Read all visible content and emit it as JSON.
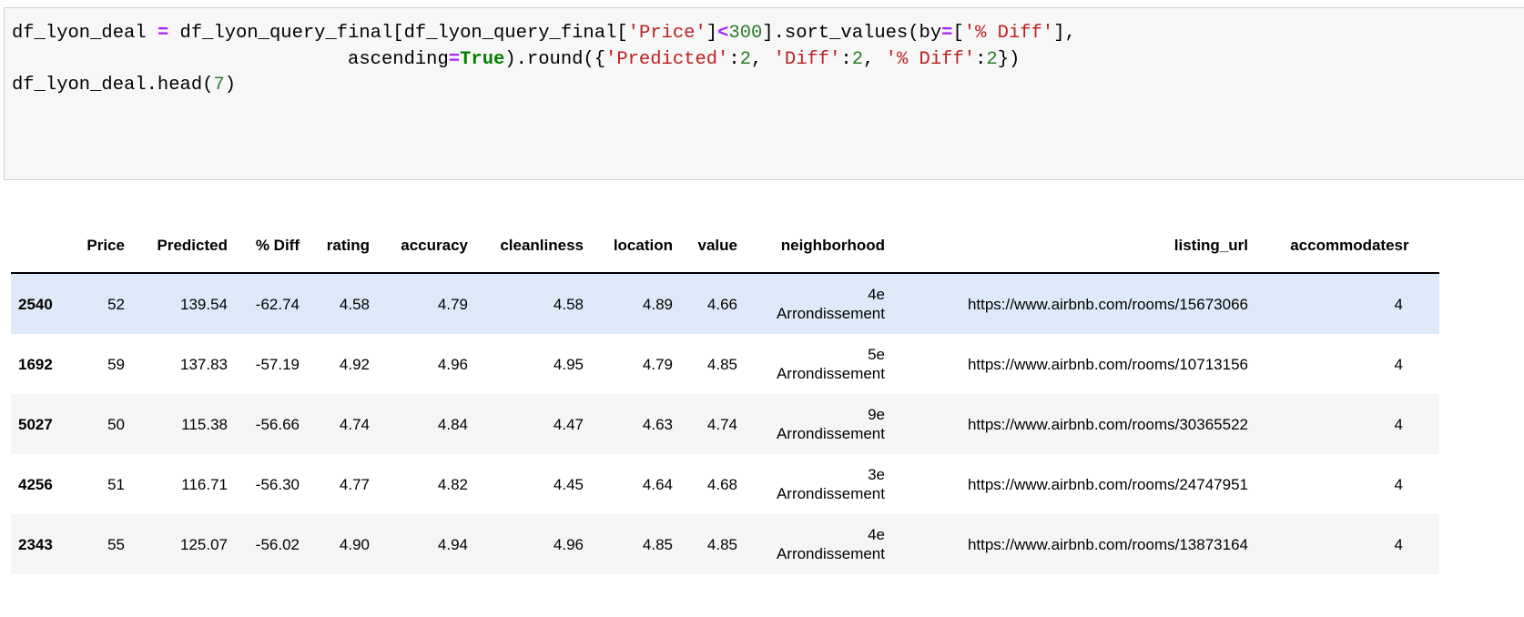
{
  "code_cell": {
    "lines": [
      [
        {
          "t": "df_lyon_deal ",
          "c": ""
        },
        {
          "t": "=",
          "c": "op"
        },
        {
          "t": " df_lyon_query_final[df_lyon_query_final[",
          "c": ""
        },
        {
          "t": "'Price'",
          "c": "str"
        },
        {
          "t": "]",
          "c": ""
        },
        {
          "t": "<",
          "c": "op"
        },
        {
          "t": "300",
          "c": "num"
        },
        {
          "t": "].sort_values(by",
          "c": ""
        },
        {
          "t": "=",
          "c": "op"
        },
        {
          "t": "[",
          "c": ""
        },
        {
          "t": "'% Diff'",
          "c": "str"
        },
        {
          "t": "],",
          "c": ""
        }
      ],
      [
        {
          "t": "                              ascending",
          "c": ""
        },
        {
          "t": "=",
          "c": "op"
        },
        {
          "t": "True",
          "c": "kw"
        },
        {
          "t": ").round({",
          "c": ""
        },
        {
          "t": "'Predicted'",
          "c": "str"
        },
        {
          "t": ":",
          "c": ""
        },
        {
          "t": "2",
          "c": "num"
        },
        {
          "t": ", ",
          "c": ""
        },
        {
          "t": "'Diff'",
          "c": "str"
        },
        {
          "t": ":",
          "c": ""
        },
        {
          "t": "2",
          "c": "num"
        },
        {
          "t": ", ",
          "c": ""
        },
        {
          "t": "'% Diff'",
          "c": "str"
        },
        {
          "t": ":",
          "c": ""
        },
        {
          "t": "2",
          "c": "num"
        },
        {
          "t": "})",
          "c": ""
        }
      ],
      [
        {
          "t": "df_lyon_deal.head(",
          "c": ""
        },
        {
          "t": "7",
          "c": "num"
        },
        {
          "t": ")",
          "c": ""
        }
      ]
    ]
  },
  "table": {
    "columns": [
      "",
      "Price",
      "Predicted",
      "% Diff",
      "rating",
      "accuracy",
      "cleanliness",
      "location",
      "value",
      "neighborhood",
      "listing_url",
      "accommodates",
      "r"
    ],
    "rows": [
      [
        "2540",
        "52",
        "139.54",
        "-62.74",
        "4.58",
        "4.79",
        "4.58",
        "4.89",
        "4.66",
        "4e Arrondissement",
        "https://www.airbnb.com/rooms/15673066",
        "4",
        ""
      ],
      [
        "1692",
        "59",
        "137.83",
        "-57.19",
        "4.92",
        "4.96",
        "4.95",
        "4.79",
        "4.85",
        "5e Arrondissement",
        "https://www.airbnb.com/rooms/10713156",
        "4",
        ""
      ],
      [
        "5027",
        "50",
        "115.38",
        "-56.66",
        "4.74",
        "4.84",
        "4.47",
        "4.63",
        "4.74",
        "9e Arrondissement",
        "https://www.airbnb.com/rooms/30365522",
        "4",
        ""
      ],
      [
        "4256",
        "51",
        "116.71",
        "-56.30",
        "4.77",
        "4.82",
        "4.45",
        "4.64",
        "4.68",
        "3e Arrondissement",
        "https://www.airbnb.com/rooms/24747951",
        "4",
        ""
      ],
      [
        "2343",
        "55",
        "125.07",
        "-56.02",
        "4.90",
        "4.94",
        "4.96",
        "4.85",
        "4.85",
        "4e Arrondissement",
        "https://www.airbnb.com/rooms/13873164",
        "4",
        ""
      ]
    ],
    "highlighted_row": 0,
    "colors": {
      "highlight": "#dde9f8",
      "stripe": "#f5f5f5",
      "code_bg": "#f7f7f7"
    }
  }
}
